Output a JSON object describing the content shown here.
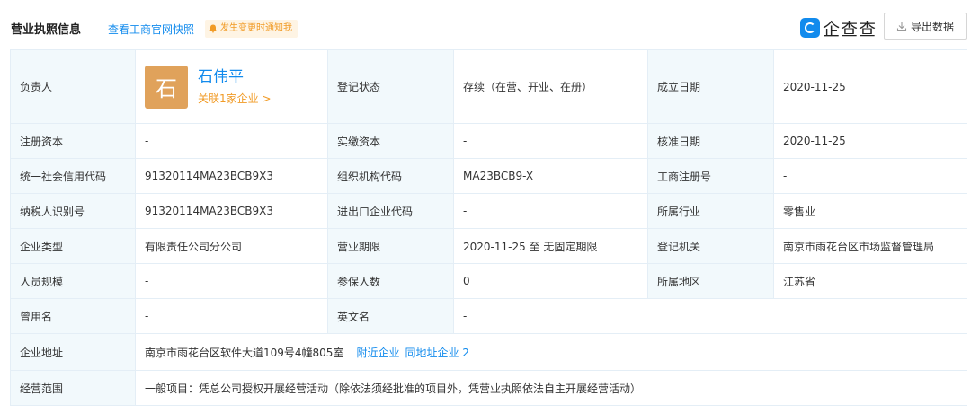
{
  "header": {
    "title": "营业执照信息",
    "link_gs": "查看工商官网快照",
    "notify": "发生变更时通知我",
    "logo_text": "企查查",
    "export_label": "导出数据"
  },
  "person": {
    "label": "负责人",
    "avatar_char": "石",
    "name": "石伟平",
    "related": "关联1家企业 >"
  },
  "rows": {
    "status_label": "登记状态",
    "status_value": "存续（在营、开业、在册）",
    "found_label": "成立日期",
    "found_value": "2020-11-25",
    "capital_label": "注册资本",
    "capital_value": "-",
    "paid_label": "实缴资本",
    "paid_value": "-",
    "approve_label": "核准日期",
    "approve_value": "2020-11-25",
    "credit_label": "统一社会信用代码",
    "credit_value": "91320114MA23BCB9X3",
    "org_label": "组织机构代码",
    "org_value": "MA23BCB9-X",
    "reg_label": "工商注册号",
    "reg_value": "-",
    "tax_label": "纳税人识别号",
    "tax_value": "91320114MA23BCB9X3",
    "import_label": "进出口企业代码",
    "import_value": "-",
    "industry_label": "所属行业",
    "industry_value": "零售业",
    "type_label": "企业类型",
    "type_value": "有限责任公司分公司",
    "term_label": "营业期限",
    "term_value": "2020-11-25 至 无固定期限",
    "authority_label": "登记机关",
    "authority_value": "南京市雨花台区市场监督管理局",
    "staff_label": "人员规模",
    "staff_value": "-",
    "insured_label": "参保人数",
    "insured_value": "0",
    "region_label": "所属地区",
    "region_value": "江苏省",
    "former_label": "曾用名",
    "former_value": "-",
    "english_label": "英文名",
    "english_value": "-",
    "address_label": "企业地址",
    "address_value": "南京市雨花台区软件大道109号4幢805室",
    "nearby_link": "附近企业",
    "same_addr_link": "同地址企业 2",
    "scope_label": "经营范围",
    "scope_value": "一般项目：凭总公司授权开展经营活动（除依法须经批准的项目外，凭营业执照依法自主开展经营活动）"
  }
}
